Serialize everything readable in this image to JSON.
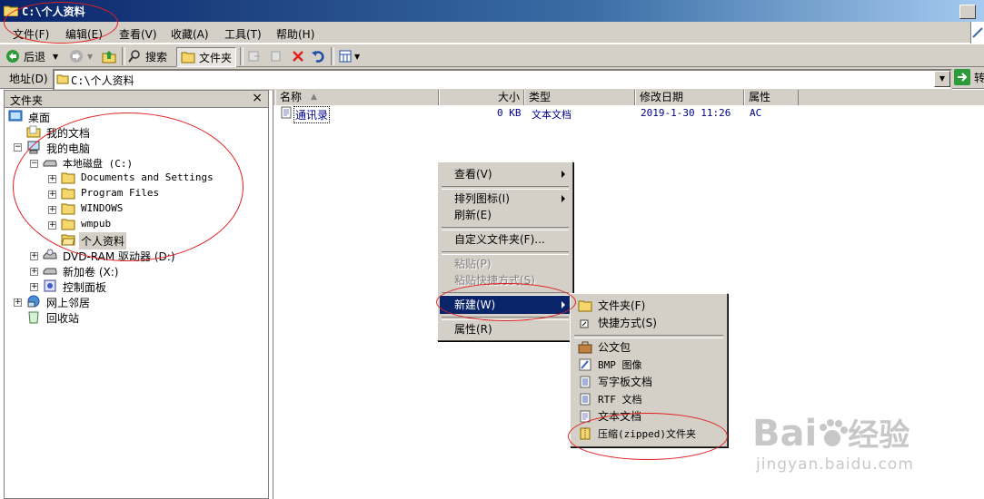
{
  "window": {
    "title": "C:\\个人资料"
  },
  "menubar": {
    "items": [
      {
        "label": "文件(F)"
      },
      {
        "label": "编辑(E)"
      },
      {
        "label": "查看(V)"
      },
      {
        "label": "收藏(A)"
      },
      {
        "label": "工具(T)"
      },
      {
        "label": "帮助(H)"
      }
    ]
  },
  "toolbar": {
    "back": "后退",
    "search": "搜索",
    "folders": "文件夹"
  },
  "address": {
    "label": "地址(D)",
    "value": "C:\\个人资料",
    "go": "转"
  },
  "leftpane": {
    "title": "文件夹",
    "close": "×",
    "tree": [
      {
        "label": "桌面"
      },
      {
        "label": "我的文档"
      },
      {
        "label": "我的电脑"
      },
      {
        "label": "本地磁盘 (C:)"
      },
      {
        "label": "Documents and Settings"
      },
      {
        "label": "Program Files"
      },
      {
        "label": "WINDOWS"
      },
      {
        "label": "wmpub"
      },
      {
        "label": "个人资料"
      },
      {
        "label": "DVD-RAM 驱动器 (D:)"
      },
      {
        "label": "新加卷 (X:)"
      },
      {
        "label": "控制面板"
      },
      {
        "label": "网上邻居"
      },
      {
        "label": "回收站"
      }
    ]
  },
  "filelist": {
    "columns": [
      "名称",
      "大小",
      "类型",
      "修改日期",
      "属性"
    ],
    "rows": [
      {
        "name": "通讯录",
        "size": "0 KB",
        "type": "文本文档",
        "date": "2019-1-30 11:26",
        "attr": "AC"
      }
    ]
  },
  "contextmenu": {
    "items": [
      {
        "label": "查看(V)"
      },
      {
        "label": "排列图标(I)"
      },
      {
        "label": "刷新(E)"
      },
      {
        "label": "自定义文件夹(F)..."
      },
      {
        "label": "粘贴(P)"
      },
      {
        "label": "粘贴快捷方式(S)"
      },
      {
        "label": "新建(W)"
      },
      {
        "label": "属性(R)"
      }
    ]
  },
  "submenu": {
    "items": [
      {
        "label": "文件夹(F)"
      },
      {
        "label": "快捷方式(S)"
      },
      {
        "label": "公文包"
      },
      {
        "label": "BMP 图像"
      },
      {
        "label": "写字板文档"
      },
      {
        "label": "RTF 文档"
      },
      {
        "label": "文本文档"
      },
      {
        "label": "压缩(zipped)文件夹"
      }
    ]
  },
  "watermark": {
    "brand": "Bai",
    "brand2": "经验",
    "url": "jingyan.baidu.com"
  },
  "colors": {
    "titlebar": "#0a246a",
    "selection": "#0a246a",
    "face": "#d4d0c8",
    "annotation": "#e02020",
    "link": "#00008b"
  }
}
